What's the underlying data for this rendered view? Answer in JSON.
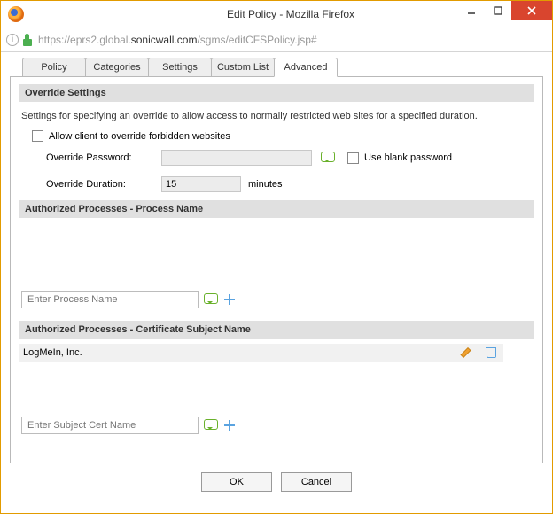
{
  "window": {
    "title": "Edit Policy - Mozilla Firefox"
  },
  "addressbar": {
    "scheme": "https://",
    "subhost": "eprs2.global.",
    "host": "sonicwall.com",
    "path": "/sgms/editCFSPolicy.jsp#"
  },
  "tabs": [
    "Policy",
    "Categories",
    "Settings",
    "Custom List",
    "Advanced"
  ],
  "active_tab": "Advanced",
  "sections": {
    "override_title": "Override Settings",
    "override_desc": "Settings for specifying an override to allow access to normally restricted web sites for a specified duration.",
    "allow_override_label": "Allow client to override forbidden websites",
    "password_label": "Override Password:",
    "password_value": "",
    "use_blank_label": "Use blank password",
    "duration_label": "Override Duration:",
    "duration_value": "15",
    "duration_unit": "minutes",
    "proc_title": "Authorized Processes - Process Name",
    "proc_placeholder": "Enter Process Name",
    "cert_title": "Authorized Processes - Certificate Subject Name",
    "cert_items": [
      {
        "name": "LogMeIn, Inc."
      }
    ],
    "cert_placeholder": "Enter Subject Cert Name"
  },
  "buttons": {
    "ok": "OK",
    "cancel": "Cancel"
  }
}
